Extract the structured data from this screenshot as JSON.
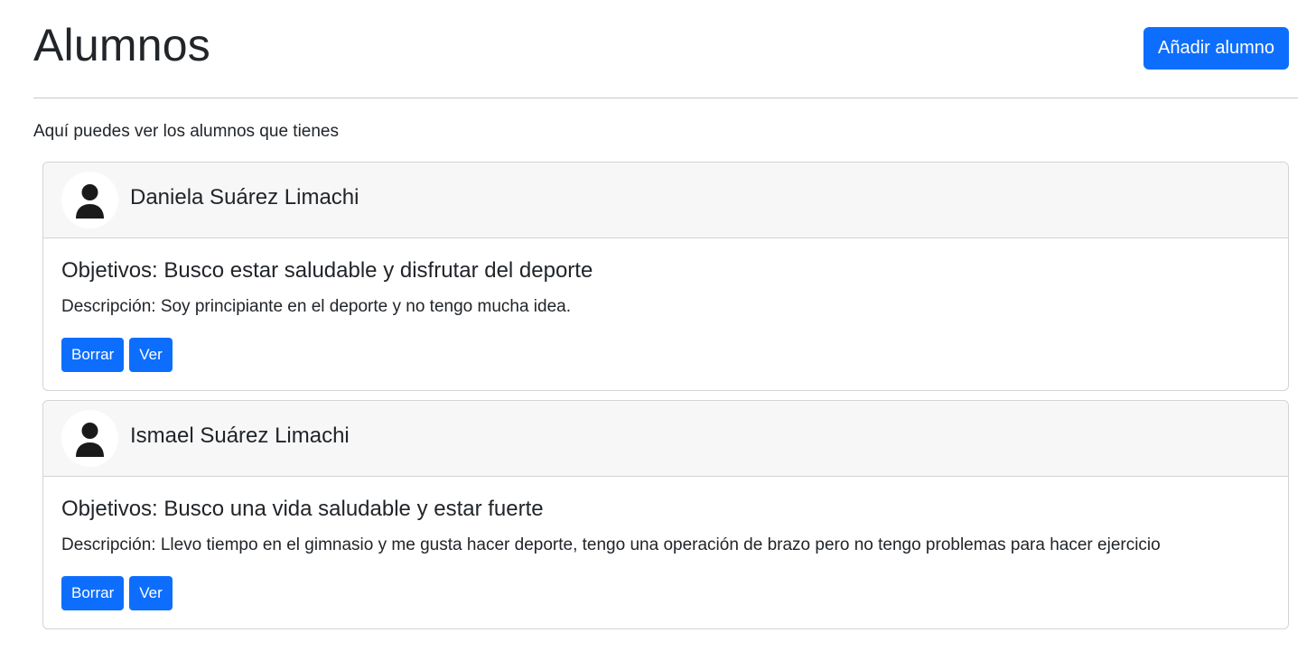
{
  "header": {
    "title": "Alumnos",
    "add_button_label": "Añadir alumno"
  },
  "subtitle": "Aquí puedes ver los alumnos que tienes",
  "students": [
    {
      "name": "Daniela Suárez Limachi",
      "objectives": "Objetivos: Busco estar saludable y disfrutar del deporte",
      "description": "Descripción: Soy principiante en el deporte y no tengo mucha idea.",
      "delete_label": "Borrar",
      "view_label": "Ver",
      "avatar_icon": "person-icon"
    },
    {
      "name": "Ismael Suárez Limachi",
      "objectives": "Objetivos: Busco una vida saludable y estar fuerte",
      "description": "Descripción: Llevo tiempo en el gimnasio y me gusta hacer deporte, tengo una operación de brazo pero no tengo problemas para hacer ejercicio",
      "delete_label": "Borrar",
      "view_label": "Ver",
      "avatar_icon": "person-icon"
    }
  ],
  "colors": {
    "primary": "#0d6efd",
    "card_header_bg": "#f7f7f7",
    "text": "#212529"
  }
}
